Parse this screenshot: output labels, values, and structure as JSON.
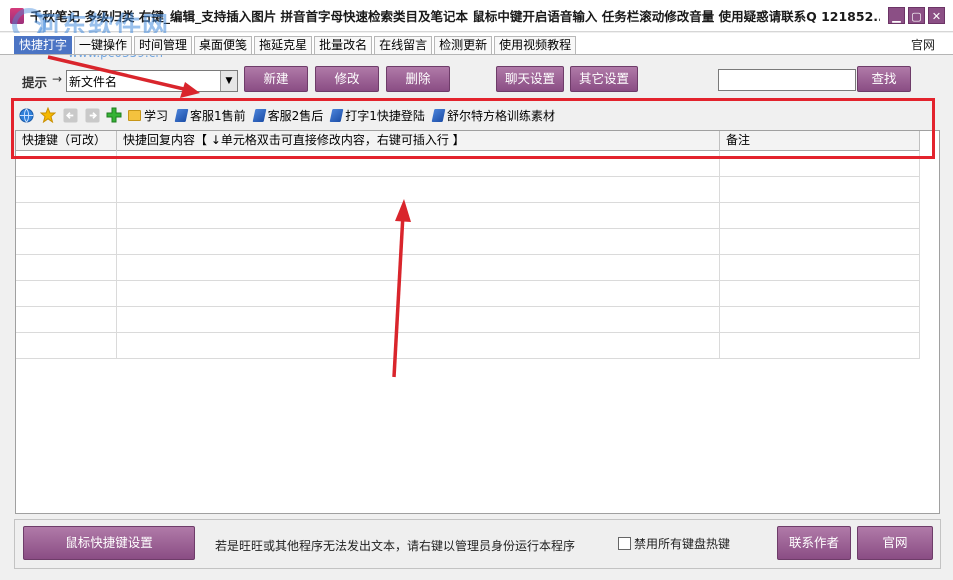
{
  "window": {
    "title": "千秋笔记  多级归类  右键_编辑_支持插入图片  拼音首字母快速检索类目及笔记本  鼠标中键开启语音输入  任务栏滚动修改音量  使用疑惑请联系Q 121852...",
    "minimize": "▁",
    "maximize": "▢",
    "close": "✕"
  },
  "watermark": {
    "main": "河东软件网",
    "url": "www.pc0359.cn"
  },
  "tabs": [
    {
      "label": "快捷打字",
      "active": true
    },
    {
      "label": "一键操作"
    },
    {
      "label": "时间管理"
    },
    {
      "label": "桌面便笺"
    },
    {
      "label": "拖延克星"
    },
    {
      "label": "批量改名"
    },
    {
      "label": "在线留言"
    },
    {
      "label": "检测更新"
    },
    {
      "label": "使用视频教程"
    }
  ],
  "official_link": "官网",
  "controls": {
    "hint_label": "提示",
    "hint_arrow": "→",
    "file_value": "新文件名",
    "combo_arrow": "▼",
    "new_button": "新建",
    "edit_button": "修改",
    "delete_button": "删除",
    "chat_settings_button": "聊天设置",
    "other_settings_button": "其它设置",
    "search_value": "",
    "search_button": "查找"
  },
  "toolbar": {
    "items": [
      {
        "label": "学习",
        "icon": "folder-icon"
      },
      {
        "label": "客服1售前",
        "icon": "book-icon"
      },
      {
        "label": "客服2售后",
        "icon": "book-icon"
      },
      {
        "label": "打字1快捷登陆",
        "icon": "book-icon"
      },
      {
        "label": "舒尔特方格训练素材",
        "icon": "book-icon"
      }
    ]
  },
  "grid": {
    "columns": [
      "快捷键（可改）",
      "快捷回复内容【 ↓单元格双击可直接修改内容，右键可插入行 】",
      "备注"
    ],
    "row_count": 8
  },
  "bottom": {
    "mouse_shortcut_button": "鼠标快捷键设置",
    "note": "若是旺旺或其他程序无法发出文本，请右键以管理员身份运行本程序",
    "disable_hotkeys_label": "禁用所有键盘热键",
    "disable_hotkeys_checked": false,
    "contact_button": "联系作者",
    "official_button": "官网"
  },
  "colors": {
    "button": "#8a4d84",
    "active_tab": "#4b74c4",
    "annotation": "#e3232d"
  }
}
